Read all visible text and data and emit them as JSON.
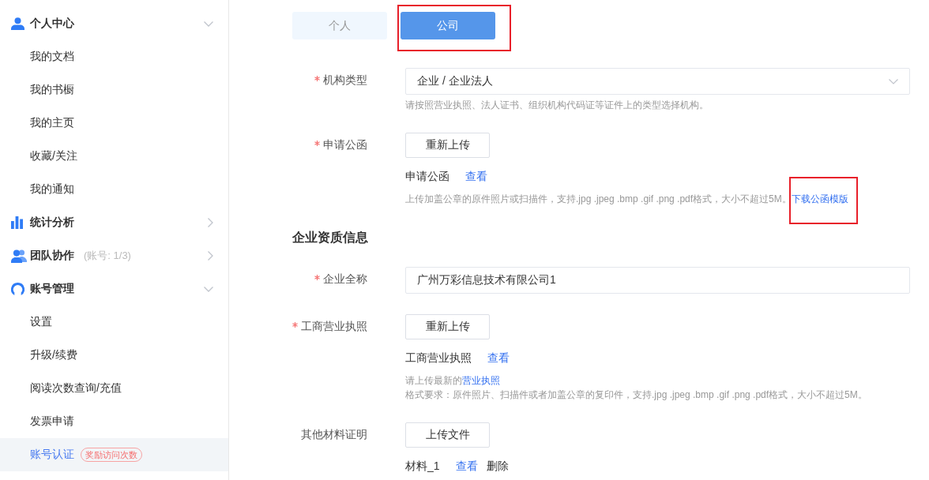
{
  "sidebar": {
    "groups": [
      {
        "label": "个人中心",
        "expanded": true,
        "items": [
          {
            "label": "我的文档",
            "selected": false
          },
          {
            "label": "我的书橱",
            "selected": false
          },
          {
            "label": "我的主页",
            "selected": false
          },
          {
            "label": "收藏/关注",
            "selected": false
          },
          {
            "label": "我的通知",
            "selected": false
          }
        ]
      },
      {
        "label": "统计分析",
        "expanded": false
      },
      {
        "label": "团队协作",
        "note": "(账号: 1/3)",
        "expanded": false
      },
      {
        "label": "账号管理",
        "expanded": true,
        "items": [
          {
            "label": "设置",
            "selected": false
          },
          {
            "label": "升级/续费",
            "selected": false
          },
          {
            "label": "阅读次数查询/充值",
            "selected": false
          },
          {
            "label": "发票申请",
            "selected": false
          },
          {
            "label": "账号认证",
            "selected": true,
            "badge": "奖励访问次数"
          }
        ]
      }
    ]
  },
  "tabs": [
    {
      "label": "个人",
      "selected": false,
      "highlighted": false
    },
    {
      "label": "公司",
      "selected": true,
      "highlighted": true
    }
  ],
  "sections": [
    {
      "rows": [
        {
          "kind": "select",
          "label": "机构类型",
          "required": true,
          "value": "企业 / 企业法人",
          "help": [
            {
              "text": "请按照营业执照、法人证书、组织机构代码证等证件上的类型选择机构。"
            }
          ]
        },
        {
          "kind": "upload",
          "label": "申请公函",
          "required": true,
          "button": "重新上传",
          "files": [
            {
              "name": "申请公函",
              "actions": [
                {
                  "kind": "view",
                  "label": "查看"
                }
              ]
            }
          ],
          "help": [
            {
              "text": "上传加盖公章的原件照片或扫描件，支持.jpg .jpeg .bmp .gif .png .pdf格式，大小不超过5M。",
              "link": "下载公函模版",
              "highlighted": true
            }
          ]
        }
      ]
    },
    {
      "title": "企业资质信息",
      "rows": [
        {
          "kind": "input",
          "label": "企业全称",
          "required": true,
          "value": "广州万彩信息技术有限公司1"
        },
        {
          "kind": "upload",
          "label": "工商营业执照",
          "required": true,
          "button": "重新上传",
          "files": [
            {
              "name": "工商营业执照",
              "actions": [
                {
                  "kind": "view",
                  "label": "查看"
                }
              ]
            }
          ],
          "help": [
            {
              "text": "请上传最新的",
              "link": "营业执照",
              "highlighted": false
            },
            {
              "text": "格式要求：原件照片、扫描件或者加盖公章的复印件，支持.jpg .jpeg .bmp .gif .png .pdf格式，大小不超过5M。"
            }
          ]
        },
        {
          "kind": "upload",
          "label": "其他材料证明",
          "required": false,
          "button": "上传文件",
          "files": [
            {
              "name": "材料_1",
              "actions": [
                {
                  "kind": "view",
                  "label": "查看"
                },
                {
                  "kind": "delete",
                  "label": "删除"
                }
              ]
            }
          ]
        }
      ]
    }
  ]
}
